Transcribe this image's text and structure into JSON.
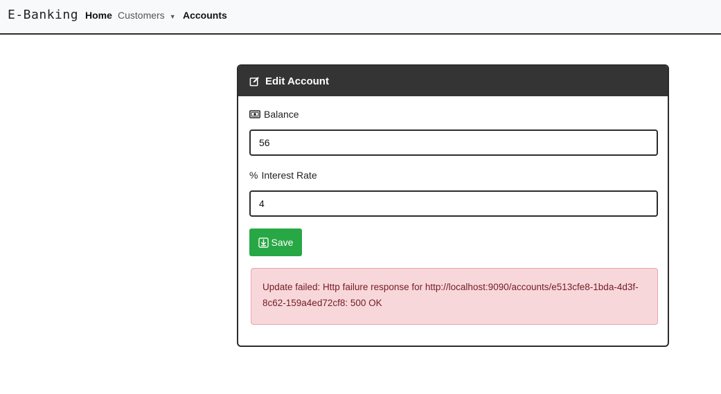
{
  "navbar": {
    "brand": "E-Banking",
    "items": [
      {
        "label": "Home"
      },
      {
        "label": "Customers",
        "dropdown": true
      },
      {
        "label": "Accounts"
      }
    ]
  },
  "card": {
    "title": "Edit Account",
    "title_icon": "edit-icon",
    "fields": {
      "balance": {
        "label": "Balance",
        "icon": "cash-icon",
        "value": "56"
      },
      "interest_rate": {
        "label": "Interest Rate",
        "icon": "percent-icon",
        "value": "4"
      }
    },
    "save_label": "Save",
    "save_icon": "download-icon",
    "error_message": "Update failed: Http failure response for http://localhost:9090/accounts/e513cfe8-1bda-4d3f-8c62-159a4ed72cf8: 500 OK"
  },
  "colors": {
    "header_bg": "#343434",
    "save_button": "#28a745",
    "alert_bg": "#f8d7da",
    "alert_text": "#721c24"
  }
}
